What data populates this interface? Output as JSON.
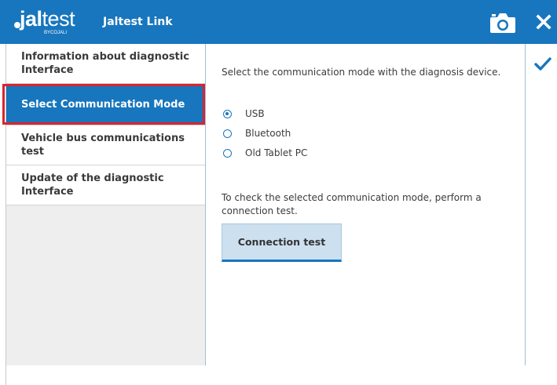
{
  "header": {
    "logo_text_prefix": "j",
    "logo_text_bold": "al",
    "logo_text_suffix": "test",
    "logo_subtext": "BYCOJALI",
    "app_title": "Jaltest Link",
    "background_color": "#1776bd",
    "camera_icon": "camera-icon",
    "close_icon": "close-icon"
  },
  "sidebar": {
    "items": [
      {
        "label": "Information about diagnostic Interface",
        "selected": false
      },
      {
        "label": "Select Communication Mode",
        "selected": true
      },
      {
        "label": "Vehicle bus communications test",
        "selected": false
      },
      {
        "label": "Update of the diagnostic Interface",
        "selected": false
      }
    ],
    "highlight_color": "#d7262e"
  },
  "main": {
    "instruction": "Select the communication mode with the diagnosis device.",
    "modes": [
      {
        "label": "USB",
        "checked": true
      },
      {
        "label": "Bluetooth",
        "checked": false
      },
      {
        "label": "Old Tablet PC",
        "checked": false
      }
    ],
    "hint": "To check the selected communication mode, perform a connection test.",
    "connection_test_label": "Connection test",
    "confirm_icon": "checkmark-icon"
  }
}
